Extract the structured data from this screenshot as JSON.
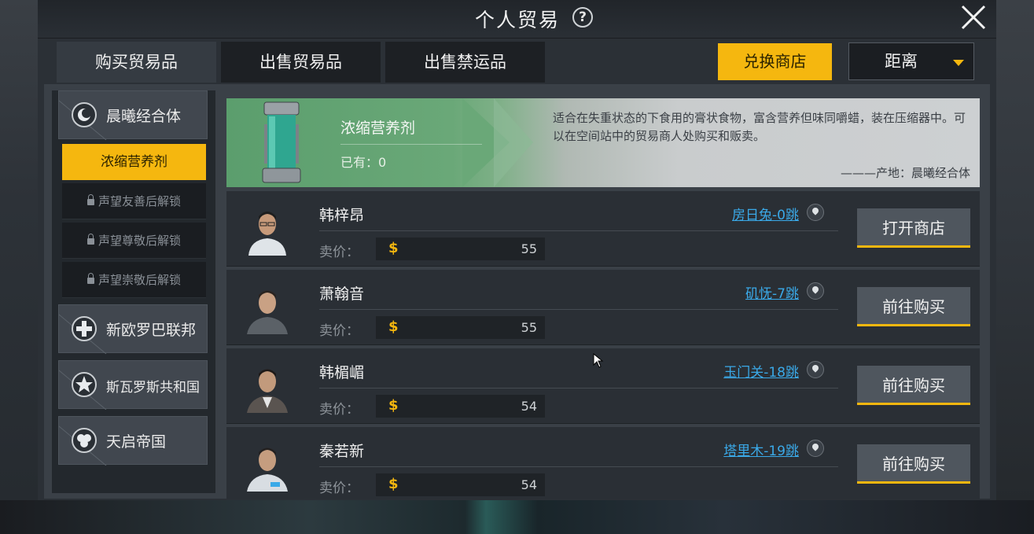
{
  "window": {
    "title": "个人贸易",
    "help_icon": "?"
  },
  "tabs": [
    {
      "label": "购买贸易品",
      "active": true
    },
    {
      "label": "出售贸易品",
      "active": false
    },
    {
      "label": "出售禁运品",
      "active": false
    }
  ],
  "exchange_button": "兑换商店",
  "sort": {
    "label": "距离"
  },
  "colors": {
    "accent": "#f5b70f",
    "link": "#3aa9e8"
  },
  "sidebar": {
    "factions": [
      {
        "label": "晨曦经合体",
        "icon": "crescent-emblem-icon"
      },
      {
        "label": "新欧罗巴联邦",
        "icon": "cross-emblem-icon"
      },
      {
        "label": "斯瓦罗斯共和国",
        "icon": "star-emblem-icon"
      },
      {
        "label": "天启帝国",
        "icon": "orb-emblem-icon"
      }
    ],
    "subitems": [
      {
        "label": "浓缩营养剂",
        "locked": false,
        "active": true
      },
      {
        "label": "声望友善后解锁",
        "locked": true
      },
      {
        "label": "声望尊敬后解锁",
        "locked": true
      },
      {
        "label": "声望崇敬后解锁",
        "locked": true
      }
    ]
  },
  "item": {
    "name": "浓缩营养剂",
    "owned": "已有：0",
    "description": "适合在失重状态的下食用的膏状食物，富含营养但味同嚼蜡，装在压缩器中。可以在空间站中的贸易商人处购买和贩卖。",
    "origin": "———产地：晨曦经合体"
  },
  "price_label": "卖价：",
  "traders": [
    {
      "name": "韩梓昂",
      "location": "房日兔-0跳",
      "price": "55",
      "action": "打开商店"
    },
    {
      "name": "萧翰音",
      "location": "矶怃-7跳",
      "price": "55",
      "action": "前往购买"
    },
    {
      "name": "韩楣嵋",
      "location": "玉门关-18跳",
      "price": "54",
      "action": "前往购买"
    },
    {
      "name": "秦若新",
      "location": "塔里木-19跳",
      "price": "54",
      "action": "前往购买"
    }
  ]
}
